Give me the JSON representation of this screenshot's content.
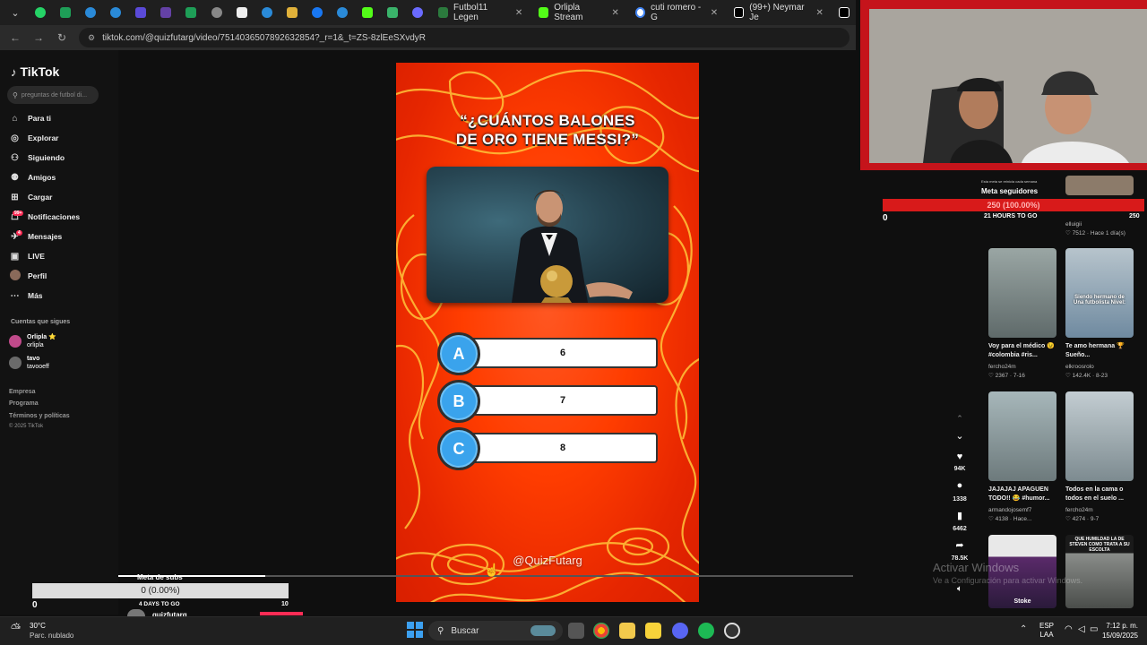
{
  "browser": {
    "tabs": [
      {
        "label": "Futbol11 Legen",
        "icon": "futbol11-icon",
        "color": "#2b7a3d"
      },
      {
        "label": "Orlipla Stream",
        "icon": "kick-icon",
        "color": "#53fc18"
      },
      {
        "label": "cuti romero - G",
        "icon": "google-icon",
        "color": "#4285f4"
      },
      {
        "label": "(99+) Neymar Je",
        "icon": "tiktok-icon",
        "color": "#ffffff"
      }
    ],
    "url": "tiktok.com/@quizfutarg/video/7514036507892632854?_r=1&_t=ZS-8zlEeSXvdyR"
  },
  "tiktok": {
    "logo": "TikTok",
    "search_placeholder": "preguntas de futbol di...",
    "nav": [
      {
        "label": "Para ti",
        "icon": "home-icon"
      },
      {
        "label": "Explorar",
        "icon": "compass-icon"
      },
      {
        "label": "Siguiendo",
        "icon": "following-icon"
      },
      {
        "label": "Amigos",
        "icon": "friends-icon"
      },
      {
        "label": "Cargar",
        "icon": "upload-icon"
      },
      {
        "label": "Notificaciones",
        "icon": "bell-icon",
        "badge": "99+"
      },
      {
        "label": "Mensajes",
        "icon": "message-icon",
        "badge": "4"
      },
      {
        "label": "LIVE",
        "icon": "live-icon"
      },
      {
        "label": "Perfil",
        "icon": "profile-icon"
      },
      {
        "label": "Más",
        "icon": "more-icon"
      }
    ],
    "following_title": "Cuentas que sigues",
    "following": [
      {
        "name": "Orlipla ⭐",
        "handle": "orlipla",
        "color": "#c04a8a"
      },
      {
        "name": "tavo",
        "handle": "tavooeff",
        "color": "#6a6a6a"
      }
    ],
    "footer": [
      "Empresa",
      "Programa",
      "Términos y políticas",
      "© 2025 TikTok"
    ]
  },
  "video": {
    "question_line1": "“¿CUÁNTOS BALONES",
    "question_line2": "DE ORO TIENE MESSI?”",
    "options": [
      {
        "letter": "A",
        "value": "6"
      },
      {
        "letter": "B",
        "value": "7"
      },
      {
        "letter": "C",
        "value": "8"
      }
    ],
    "watermark": "@QuizFutarg",
    "progress": 0.2
  },
  "actions": [
    {
      "icon": "heart-icon",
      "count": "94K"
    },
    {
      "icon": "comment-icon",
      "count": "1338"
    },
    {
      "icon": "bookmark-icon",
      "count": "6462"
    },
    {
      "icon": "share-icon",
      "count": "78.5K"
    }
  ],
  "goal": {
    "subtitle": "Esta meta se reinicia cada semana",
    "label": "Meta seguidores",
    "bar_text": "250 (100.00%)",
    "time_left": "21 HOURS TO GO",
    "min": "0",
    "max": "250"
  },
  "recommendations": [
    {
      "caption": "",
      "author": "elluigii",
      "stats": "♡ 7512 · Hace 1 día(s)",
      "color": "#8c7b6a"
    },
    {
      "caption": "Voy para el médico 😉 #colombia #ris...",
      "author": "fercho24m",
      "stats": "♡ 2367 · 7-16",
      "color": "#7d8a8a"
    },
    {
      "caption": "Te amo hermana 🏆 Sueño...",
      "author": "elkroosrolo",
      "stats": "♡ 142.4K · 8-23",
      "color": "#6f8aa0",
      "overlay": "Siendo hermano de Una futbolista Nivel:"
    },
    {
      "caption": "JAJAJAJ APAGUEN TODO!! 😂 #humor...",
      "author": "armandojosemf7",
      "stats": "♡ 4138 · Hace...",
      "color": "#8f9d9f"
    },
    {
      "caption": "Todos en la cama o todos en el suelo ...",
      "author": "fercho24m",
      "stats": "♡ 4274 · 9-7",
      "color": "#93a0a6"
    },
    {
      "caption": "",
      "author": "",
      "stats": "",
      "color": "#5a2a6a",
      "overlay": "Stoke"
    },
    {
      "caption": "",
      "author": "",
      "stats": "",
      "color": "#6a6d6a",
      "overlay": "QUE HUMILDAD LA DE STEVEN COMO TRATA A SU ESCOLTA"
    }
  ],
  "sub_goal": {
    "title": "Meta de subs",
    "bar_text": "0 (0.00%)",
    "min": "0",
    "max": "10",
    "time_left": "4 DAYS TO GO",
    "user": "quizfutarg"
  },
  "windows": {
    "activate_title": "Activar Windows",
    "activate_sub": "Ve a Configuración para activar Windows.",
    "weather_temp": "30°C",
    "weather_desc": "Parc. nublado",
    "search": "Buscar",
    "lang1": "ESP",
    "lang2": "LAA",
    "time": "7:12 p. m.",
    "date": "15/09/2025"
  }
}
